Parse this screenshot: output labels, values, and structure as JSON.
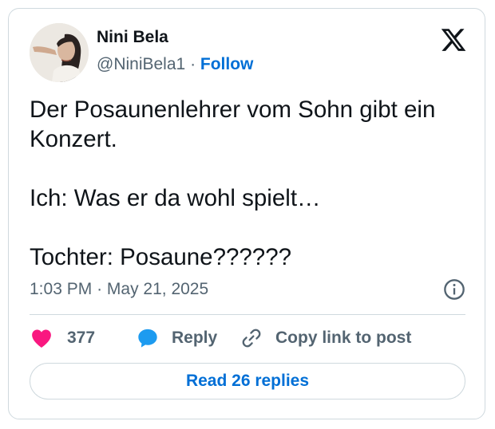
{
  "author": {
    "name": "Nini Bela",
    "handle": "@NiniBela1",
    "separator": "·",
    "follow_label": "Follow"
  },
  "tweet": {
    "lines": [
      "Der Posaunenlehrer vom Sohn gibt ein Konzert.",
      "Ich: Was er da wohl spielt…",
      "Tochter: Posaune??????"
    ],
    "time": "1:03 PM",
    "separator": "·",
    "date": "May 21, 2025"
  },
  "actions": {
    "like_count": "377",
    "reply_label": "Reply",
    "copy_label": "Copy link to post"
  },
  "read_replies_label": "Read 26 replies",
  "icons": {
    "logo": "x-logo-icon",
    "info": "info-icon",
    "like": "heart-icon",
    "reply": "speech-bubble-icon",
    "copy": "link-icon"
  },
  "colors": {
    "accent": "#006fd6",
    "like": "#f91880",
    "reply": "#1d9bf0",
    "muted": "#536471",
    "border": "#cfd9de"
  }
}
